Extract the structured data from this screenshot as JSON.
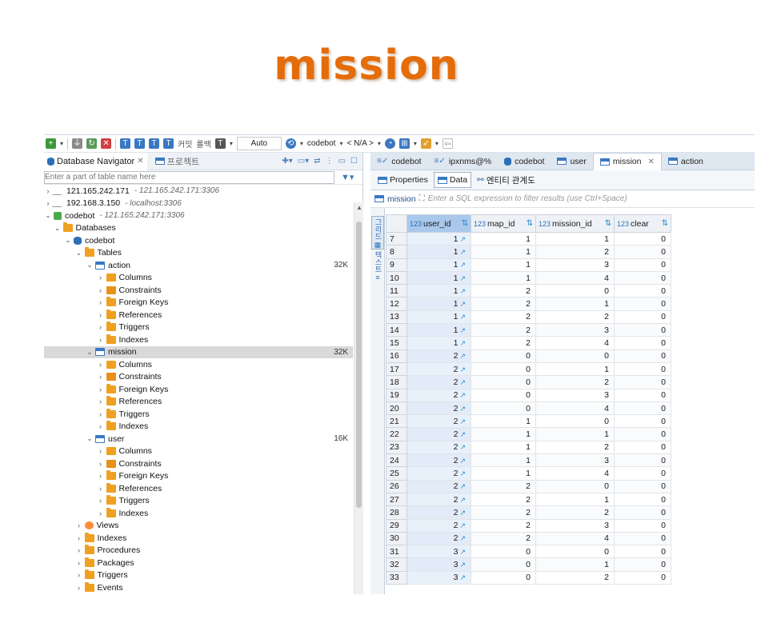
{
  "slide": {
    "title": "mission"
  },
  "toolbar": {
    "commit_label": "커밋",
    "rollback_label": "롤백",
    "mode_value": "Auto",
    "connection_value": "codebot",
    "schema_value": "< N/A >"
  },
  "navigator": {
    "tab_label": "Database Navigator",
    "tab2_label": "프로젝트",
    "filter_placeholder": "Enter a part of table name here",
    "tree": [
      {
        "depth": 0,
        "twisty": "›",
        "icon": "conn",
        "label": "121.165.242.171",
        "sub": "- 121.165.242.171:3306",
        "size": ""
      },
      {
        "depth": 0,
        "twisty": "›",
        "icon": "conn",
        "label": "192.168.3.150",
        "sub": "- localhost:3306",
        "size": ""
      },
      {
        "depth": 0,
        "twisty": "⌄",
        "icon": "connok",
        "label": "codebot",
        "sub": "- 121.165.242.171:3306",
        "size": ""
      },
      {
        "depth": 1,
        "twisty": "⌄",
        "icon": "folder",
        "label": "Databases",
        "sub": "",
        "size": ""
      },
      {
        "depth": 2,
        "twisty": "⌄",
        "icon": "db",
        "label": "codebot",
        "sub": "",
        "size": ""
      },
      {
        "depth": 3,
        "twisty": "⌄",
        "icon": "folder",
        "label": "Tables",
        "sub": "",
        "size": ""
      },
      {
        "depth": 4,
        "twisty": "⌄",
        "icon": "table",
        "label": "action",
        "sub": "",
        "size": "32K"
      },
      {
        "depth": 5,
        "twisty": "›",
        "icon": "col",
        "label": "Columns",
        "sub": "",
        "size": ""
      },
      {
        "depth": 5,
        "twisty": "›",
        "icon": "cons",
        "label": "Constraints",
        "sub": "",
        "size": ""
      },
      {
        "depth": 5,
        "twisty": "›",
        "icon": "folder",
        "label": "Foreign Keys",
        "sub": "",
        "size": ""
      },
      {
        "depth": 5,
        "twisty": "›",
        "icon": "folder",
        "label": "References",
        "sub": "",
        "size": ""
      },
      {
        "depth": 5,
        "twisty": "›",
        "icon": "folder",
        "label": "Triggers",
        "sub": "",
        "size": ""
      },
      {
        "depth": 5,
        "twisty": "›",
        "icon": "folder",
        "label": "Indexes",
        "sub": "",
        "size": ""
      },
      {
        "depth": 4,
        "twisty": "⌄",
        "icon": "table",
        "label": "mission",
        "sub": "",
        "size": "32K",
        "selected": true
      },
      {
        "depth": 5,
        "twisty": "›",
        "icon": "col",
        "label": "Columns",
        "sub": "",
        "size": ""
      },
      {
        "depth": 5,
        "twisty": "›",
        "icon": "cons",
        "label": "Constraints",
        "sub": "",
        "size": ""
      },
      {
        "depth": 5,
        "twisty": "›",
        "icon": "folder",
        "label": "Foreign Keys",
        "sub": "",
        "size": ""
      },
      {
        "depth": 5,
        "twisty": "›",
        "icon": "folder",
        "label": "References",
        "sub": "",
        "size": ""
      },
      {
        "depth": 5,
        "twisty": "›",
        "icon": "folder",
        "label": "Triggers",
        "sub": "",
        "size": ""
      },
      {
        "depth": 5,
        "twisty": "›",
        "icon": "folder",
        "label": "Indexes",
        "sub": "",
        "size": ""
      },
      {
        "depth": 4,
        "twisty": "⌄",
        "icon": "table",
        "label": "user",
        "sub": "",
        "size": "16K"
      },
      {
        "depth": 5,
        "twisty": "›",
        "icon": "col",
        "label": "Columns",
        "sub": "",
        "size": ""
      },
      {
        "depth": 5,
        "twisty": "›",
        "icon": "cons",
        "label": "Constraints",
        "sub": "",
        "size": ""
      },
      {
        "depth": 5,
        "twisty": "›",
        "icon": "folder",
        "label": "Foreign Keys",
        "sub": "",
        "size": ""
      },
      {
        "depth": 5,
        "twisty": "›",
        "icon": "folder",
        "label": "References",
        "sub": "",
        "size": ""
      },
      {
        "depth": 5,
        "twisty": "›",
        "icon": "folder",
        "label": "Triggers",
        "sub": "",
        "size": ""
      },
      {
        "depth": 5,
        "twisty": "›",
        "icon": "folder",
        "label": "Indexes",
        "sub": "",
        "size": ""
      },
      {
        "depth": 3,
        "twisty": "›",
        "icon": "views",
        "label": "Views",
        "sub": "",
        "size": ""
      },
      {
        "depth": 3,
        "twisty": "›",
        "icon": "folder",
        "label": "Indexes",
        "sub": "",
        "size": ""
      },
      {
        "depth": 3,
        "twisty": "›",
        "icon": "folder",
        "label": "Procedures",
        "sub": "",
        "size": ""
      },
      {
        "depth": 3,
        "twisty": "›",
        "icon": "folder",
        "label": "Packages",
        "sub": "",
        "size": ""
      },
      {
        "depth": 3,
        "twisty": "›",
        "icon": "folder",
        "label": "Triggers",
        "sub": "",
        "size": ""
      },
      {
        "depth": 3,
        "twisty": "›",
        "icon": "folder",
        "label": "Events",
        "sub": "",
        "size": ""
      }
    ]
  },
  "editor": {
    "tabs": [
      {
        "kind": "sql",
        "label": "codebot",
        "active": false
      },
      {
        "kind": "sql",
        "label": "ipxnms@%",
        "active": false
      },
      {
        "kind": "db",
        "label": "codebot",
        "active": false
      },
      {
        "kind": "table",
        "label": "user",
        "active": false
      },
      {
        "kind": "table",
        "label": "mission",
        "active": true
      },
      {
        "kind": "table",
        "label": "action",
        "active": false
      }
    ],
    "sub_tabs": {
      "properties": "Properties",
      "data": "Data",
      "erd": "엔티티 관계도"
    },
    "filter": {
      "table_name": "mission",
      "placeholder": "Enter a SQL expression to filter results (use Ctrl+Space)"
    },
    "side_panel": {
      "grid": "그리드",
      "text": "텍스트"
    },
    "columns": [
      {
        "type": "123",
        "name": "user_id"
      },
      {
        "type": "123",
        "name": "map_id"
      },
      {
        "type": "123",
        "name": "mission_id"
      },
      {
        "type": "123",
        "name": "clear"
      }
    ],
    "rows": [
      [
        "7",
        "1",
        "1",
        "1",
        "0"
      ],
      [
        "8",
        "1",
        "1",
        "2",
        "0"
      ],
      [
        "9",
        "1",
        "1",
        "3",
        "0"
      ],
      [
        "10",
        "1",
        "1",
        "4",
        "0"
      ],
      [
        "11",
        "1",
        "2",
        "0",
        "0"
      ],
      [
        "12",
        "1",
        "2",
        "1",
        "0"
      ],
      [
        "13",
        "1",
        "2",
        "2",
        "0"
      ],
      [
        "14",
        "1",
        "2",
        "3",
        "0"
      ],
      [
        "15",
        "1",
        "2",
        "4",
        "0"
      ],
      [
        "16",
        "2",
        "0",
        "0",
        "0"
      ],
      [
        "17",
        "2",
        "0",
        "1",
        "0"
      ],
      [
        "18",
        "2",
        "0",
        "2",
        "0"
      ],
      [
        "19",
        "2",
        "0",
        "3",
        "0"
      ],
      [
        "20",
        "2",
        "0",
        "4",
        "0"
      ],
      [
        "21",
        "2",
        "1",
        "0",
        "0"
      ],
      [
        "22",
        "2",
        "1",
        "1",
        "0"
      ],
      [
        "23",
        "2",
        "1",
        "2",
        "0"
      ],
      [
        "24",
        "2",
        "1",
        "3",
        "0"
      ],
      [
        "25",
        "2",
        "1",
        "4",
        "0"
      ],
      [
        "26",
        "2",
        "2",
        "0",
        "0"
      ],
      [
        "27",
        "2",
        "2",
        "1",
        "0"
      ],
      [
        "28",
        "2",
        "2",
        "2",
        "0"
      ],
      [
        "29",
        "2",
        "2",
        "3",
        "0"
      ],
      [
        "30",
        "2",
        "2",
        "4",
        "0"
      ],
      [
        "31",
        "3",
        "0",
        "0",
        "0"
      ],
      [
        "32",
        "3",
        "0",
        "1",
        "0"
      ],
      [
        "33",
        "3",
        "0",
        "2",
        "0"
      ]
    ]
  }
}
